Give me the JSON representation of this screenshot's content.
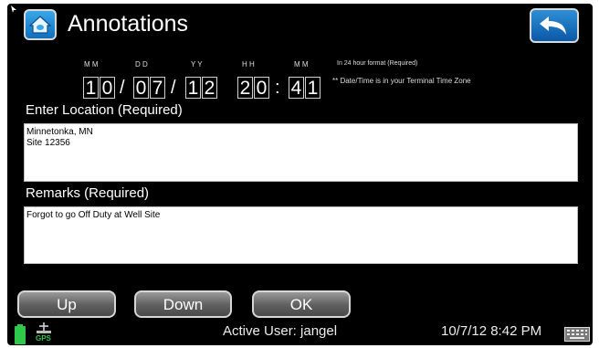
{
  "header": {
    "title": "Annotations"
  },
  "datetime": {
    "labels": {
      "month": "M M",
      "day": "D D",
      "year": "Y Y",
      "hour": "H H",
      "minute": "M M"
    },
    "format_note": "In 24 hour format (Required)",
    "timezone_note": "** Date/Time is in your Terminal Time Zone",
    "month": [
      "1",
      "0"
    ],
    "day": [
      "0",
      "7"
    ],
    "year": [
      "1",
      "2"
    ],
    "hour": [
      "2",
      "0"
    ],
    "minute": [
      "4",
      "1"
    ],
    "date_sep": "/",
    "time_sep": ":"
  },
  "location": {
    "label": "Enter Location (Required)",
    "lines": [
      "Minnetonka, MN",
      "Site 12356"
    ]
  },
  "remarks": {
    "label": "Remarks (Required)",
    "text": "Forgot to go Off Duty at Well Site"
  },
  "buttons": {
    "up": "Up",
    "down": "Down",
    "ok": "OK"
  },
  "status_bar": {
    "gps_label": "GPS",
    "active_user": "Active User: jangel",
    "datetime": "10/7/12 8:42 PM"
  },
  "icons": {
    "home": "home-icon",
    "back": "back-arrow-icon",
    "battery": "battery-icon",
    "gps": "gps-icon",
    "keyboard": "keyboard-icon"
  },
  "colors": {
    "accent_blue": "#1a7fd0",
    "battery_green": "#2ec84a",
    "background": "#000000"
  }
}
